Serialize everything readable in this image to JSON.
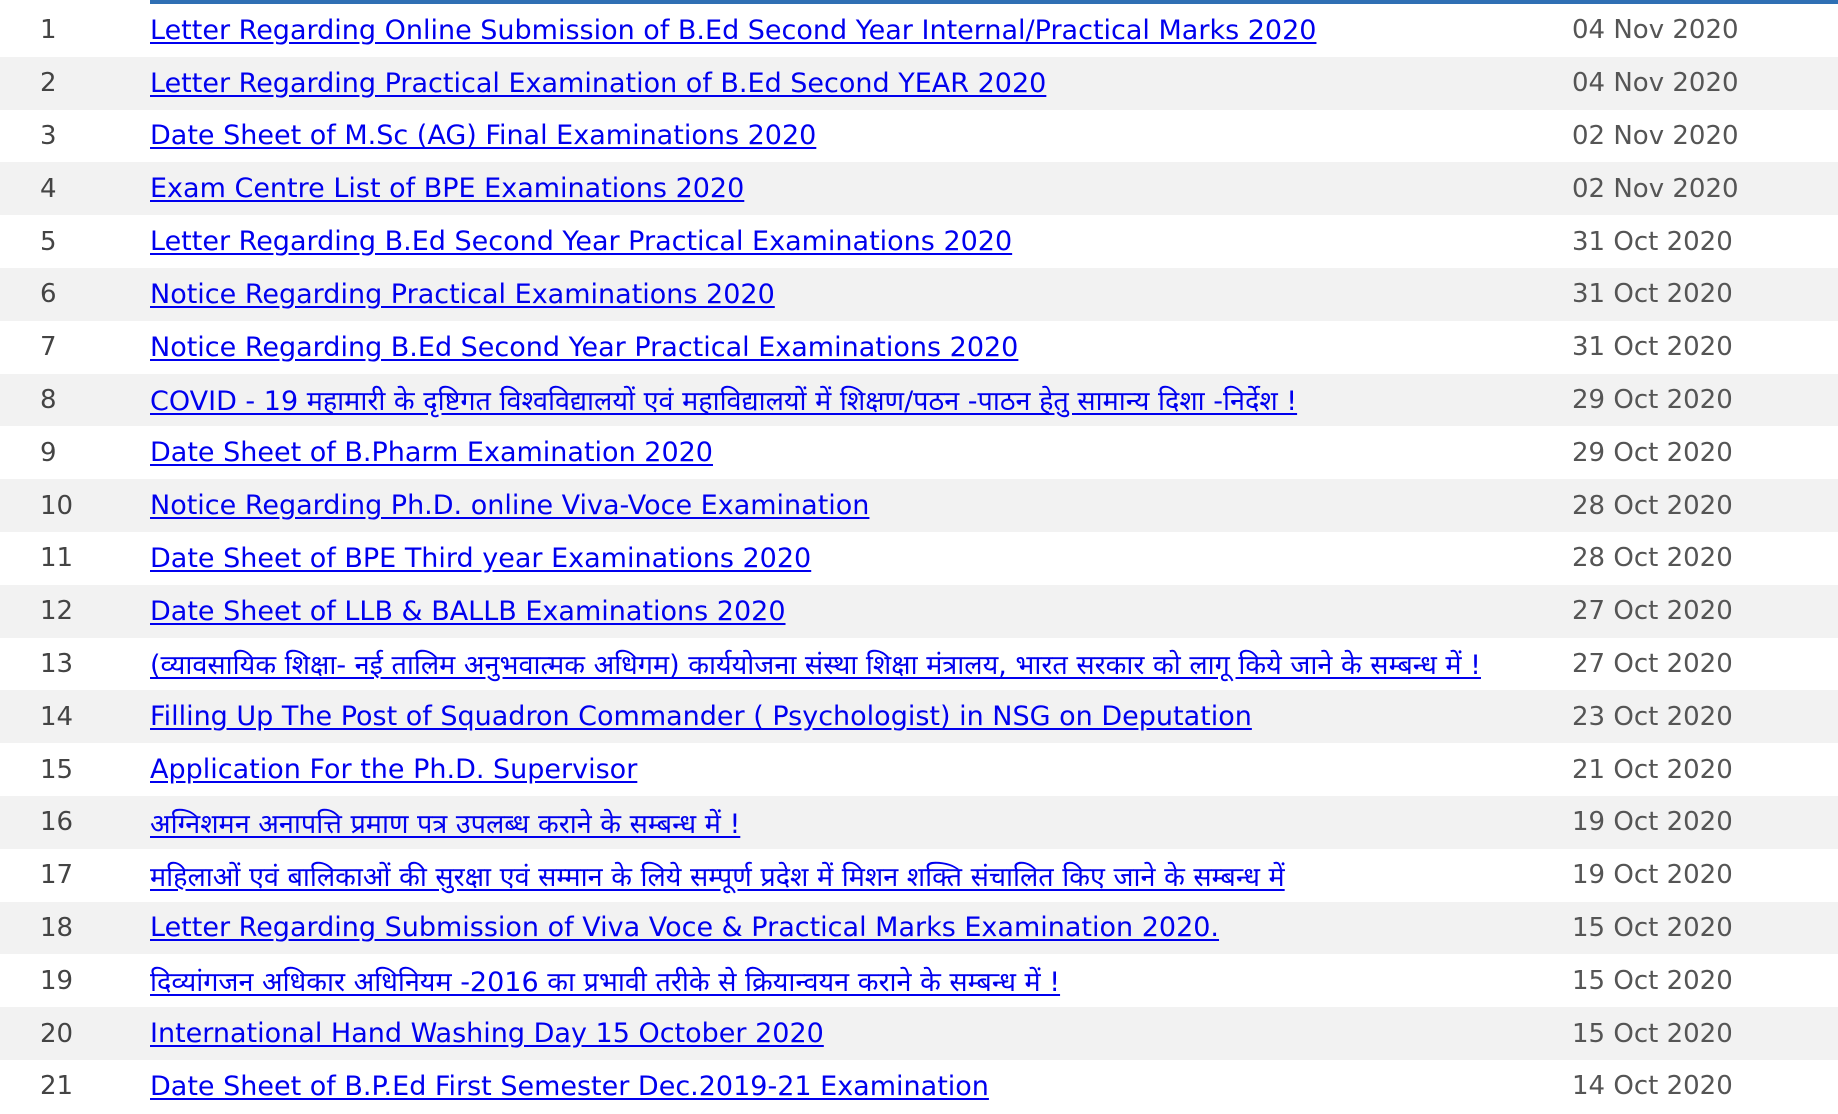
{
  "colors": {
    "link": "#0000ee",
    "row_alt": "#f2f2f2",
    "top_rule": "#2f6fb4"
  },
  "notices": [
    {
      "sn": "1",
      "title": "Letter Regarding Online Submission of B.Ed Second Year Internal/Practical Marks 2020",
      "date": "04 Nov 2020"
    },
    {
      "sn": "2",
      "title": "Letter Regarding Practical Examination of B.Ed Second YEAR 2020",
      "date": "04 Nov 2020"
    },
    {
      "sn": "3",
      "title": "Date Sheet of M.Sc (AG) Final Examinations 2020",
      "date": "02 Nov 2020"
    },
    {
      "sn": "4",
      "title": "Exam Centre List of BPE Examinations 2020",
      "date": "02 Nov 2020"
    },
    {
      "sn": "5",
      "title": "Letter Regarding B.Ed Second Year Practical Examinations 2020",
      "date": "31 Oct 2020"
    },
    {
      "sn": "6",
      "title": "Notice Regarding Practical Examinations 2020",
      "date": "31 Oct 2020"
    },
    {
      "sn": "7",
      "title": "Notice Regarding B.Ed Second Year Practical Examinations 2020",
      "date": "31 Oct 2020"
    },
    {
      "sn": "8",
      "title": "COVID - 19 महामारी के दृष्टिगत विश्वविद्यालयों एवं महाविद्यालयों में शिक्षण/पठन -पाठन हेतु सामान्य दिशा -निर्देश !",
      "date": "29 Oct 2020"
    },
    {
      "sn": "9",
      "title": "Date Sheet of B.Pharm Examination 2020",
      "date": "29 Oct 2020"
    },
    {
      "sn": "10",
      "title": "Notice Regarding Ph.D. online Viva-Voce Examination",
      "date": "28 Oct 2020"
    },
    {
      "sn": "11",
      "title": "Date Sheet of BPE Third year Examinations 2020",
      "date": "28 Oct 2020"
    },
    {
      "sn": "12",
      "title": "Date Sheet of LLB & BALLB Examinations 2020",
      "date": "27 Oct 2020"
    },
    {
      "sn": "13",
      "title": "(व्यावसायिक शिक्षा- नई तालिम अनुभवात्मक अधिगम) कार्ययोजना संस्था शिक्षा मंत्रालय, भारत सरकार को लागू किये जाने के सम्बन्ध में !",
      "date": "27 Oct 2020"
    },
    {
      "sn": "14",
      "title": "Filling Up The Post of Squadron Commander ( Psychologist) in NSG on Deputation",
      "date": "23 Oct 2020"
    },
    {
      "sn": "15",
      "title": "Application For the Ph.D. Supervisor",
      "date": "21 Oct 2020"
    },
    {
      "sn": "16",
      "title": "अग्निशमन अनापत्ति प्रमाण पत्र उपलब्ध कराने के सम्बन्ध में !",
      "date": "19 Oct 2020"
    },
    {
      "sn": "17",
      "title": "महिलाओं एवं बालिकाओं की सुरक्षा एवं सम्मान के लिये सम्पूर्ण प्रदेश में मिशन शक्ति संचालित किए जाने के सम्बन्ध में",
      "date": "19 Oct 2020"
    },
    {
      "sn": "18",
      "title": "Letter Regarding Submission of Viva Voce & Practical Marks Examination 2020.",
      "date": "15 Oct 2020"
    },
    {
      "sn": "19",
      "title": "दिव्यांगजन अधिकार अधिनियम -2016 का प्रभावी तरीके से क्रियान्वयन कराने के सम्बन्ध में !",
      "date": "15 Oct 2020"
    },
    {
      "sn": "20",
      "title": "International Hand Washing Day 15 October 2020",
      "date": "15 Oct 2020"
    },
    {
      "sn": "21",
      "title": "Date Sheet of B.P.Ed First Semester Dec.2019-21 Examination",
      "date": "14 Oct 2020"
    }
  ]
}
